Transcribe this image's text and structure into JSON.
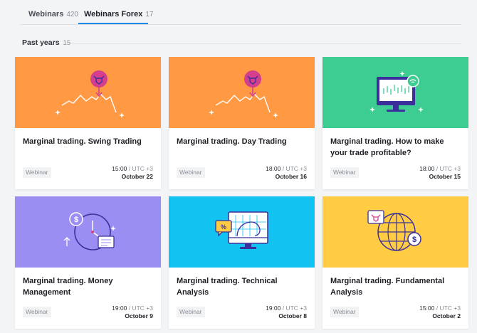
{
  "tabs": [
    {
      "label": "Webinars",
      "count": "420"
    },
    {
      "label": "Webinars Forex",
      "count": "17"
    }
  ],
  "section": {
    "title": "Past years",
    "count": "15"
  },
  "colors": {
    "orange": "#ff9944",
    "green": "#3dcc92",
    "purple": "#9b8ef2",
    "cyan": "#12c3f1",
    "yellow": "#ffcc44",
    "accent": "#1e88e5",
    "icon_dark": "#3b2f9b",
    "icon_pink": "#d43f8d"
  },
  "cards": [
    {
      "title": "Marginal trading. Swing Trading",
      "tag": "Webinar",
      "time": "15:00",
      "tz": "/ UTC +3",
      "date": "October 22",
      "icon": "bull-chart-icon"
    },
    {
      "title": "Marginal trading. Day Trading",
      "tag": "Webinar",
      "time": "18:00",
      "tz": "/ UTC +3",
      "date": "October 16",
      "icon": "bull-chart-icon"
    },
    {
      "title": "Marginal trading. How to make your trade profitable?",
      "tag": "Webinar",
      "time": "18:00",
      "tz": "/ UTC +3",
      "date": "October 15",
      "icon": "monitor-chart-icon"
    },
    {
      "title": "Marginal trading. Money Management",
      "tag": "Webinar",
      "time": "19:00",
      "tz": "/ UTC +3",
      "date": "October 9",
      "icon": "money-clock-icon"
    },
    {
      "title": "Marginal trading. Technical Analysis",
      "tag": "Webinar",
      "time": "19:00",
      "tz": "/ UTC +3",
      "date": "October 8",
      "icon": "monitor-spiral-icon"
    },
    {
      "title": "Marginal trading. Fundamental Analysis",
      "tag": "Webinar",
      "time": "15:00",
      "tz": "/ UTC +3",
      "date": "October 2",
      "icon": "globe-dollar-icon"
    }
  ]
}
